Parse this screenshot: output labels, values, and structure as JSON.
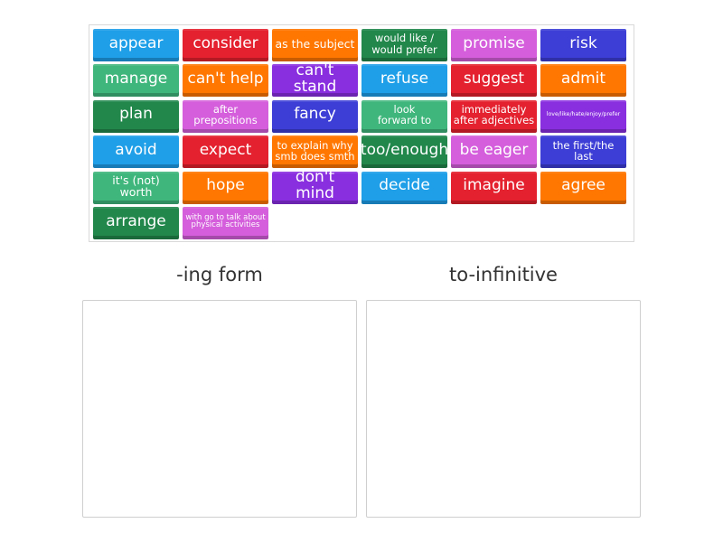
{
  "colors": {
    "blue": "#1e9fe8",
    "red": "#e4212e",
    "orange": "#ff7700",
    "dark_green": "#21874b",
    "pink": "#d45edb",
    "indigo": "#3d3ed6",
    "green": "#3fb67b",
    "purple": "#8a2fe0"
  },
  "tiles": [
    {
      "text": "appear",
      "color": "blue",
      "size": "fs-l"
    },
    {
      "text": "consider",
      "color": "red",
      "size": "fs-l"
    },
    {
      "text": "as the subject",
      "color": "orange",
      "size": "fs-m"
    },
    {
      "text": "would like /\nwould prefer",
      "color": "dark_green",
      "size": "fs-s"
    },
    {
      "text": "promise",
      "color": "pink",
      "size": "fs-l"
    },
    {
      "text": "risk",
      "color": "indigo",
      "size": "fs-l"
    },
    {
      "text": "manage",
      "color": "green",
      "size": "fs-l"
    },
    {
      "text": "can't help",
      "color": "orange",
      "size": "fs-l"
    },
    {
      "text": "can't stand",
      "color": "purple",
      "size": "fs-l"
    },
    {
      "text": "refuse",
      "color": "blue",
      "size": "fs-l"
    },
    {
      "text": "suggest",
      "color": "red",
      "size": "fs-l"
    },
    {
      "text": "admit",
      "color": "orange",
      "size": "fs-l"
    },
    {
      "text": "plan",
      "color": "dark_green",
      "size": "fs-l"
    },
    {
      "text": "after\nprepositions",
      "color": "pink",
      "size": "fs-s"
    },
    {
      "text": "fancy",
      "color": "indigo",
      "size": "fs-l"
    },
    {
      "text": "look\nforward to",
      "color": "green",
      "size": "fs-s"
    },
    {
      "text": "immediately\nafter adjectives",
      "color": "red",
      "size": "fs-s"
    },
    {
      "text": "love/like/hate/enjoy/prefer",
      "color": "purple",
      "size": "fs-xxs"
    },
    {
      "text": "avoid",
      "color": "blue",
      "size": "fs-l"
    },
    {
      "text": "expect",
      "color": "red",
      "size": "fs-l"
    },
    {
      "text": "to explain why\nsmb does smth",
      "color": "orange",
      "size": "fs-s"
    },
    {
      "text": "too/enough",
      "color": "dark_green",
      "size": "fs-l"
    },
    {
      "text": "be eager",
      "color": "pink",
      "size": "fs-l"
    },
    {
      "text": "the first/the\nlast",
      "color": "indigo",
      "size": "fs-s"
    },
    {
      "text": "it's (not) worth",
      "color": "green",
      "size": "fs-m"
    },
    {
      "text": "hope",
      "color": "orange",
      "size": "fs-l"
    },
    {
      "text": "don't mind",
      "color": "purple",
      "size": "fs-l"
    },
    {
      "text": "decide",
      "color": "blue",
      "size": "fs-l"
    },
    {
      "text": "imagine",
      "color": "red",
      "size": "fs-l"
    },
    {
      "text": "agree",
      "color": "orange",
      "size": "fs-l"
    },
    {
      "text": "arrange",
      "color": "dark_green",
      "size": "fs-l"
    },
    {
      "text": "with go to talk about\nphysical activities",
      "color": "pink",
      "size": "fs-xs"
    }
  ],
  "groups": {
    "ing_label": "-ing form",
    "to_label": "to-infinitive"
  }
}
